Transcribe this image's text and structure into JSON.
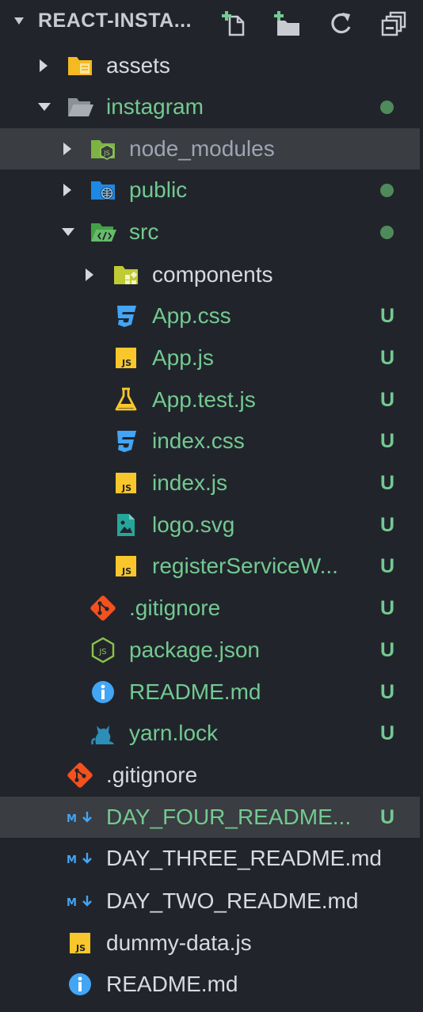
{
  "header": {
    "title": "REACT-INSTA...",
    "actions": [
      {
        "name": "new-file-button",
        "icon": "new-file-icon"
      },
      {
        "name": "new-folder-button",
        "icon": "new-folder-icon"
      },
      {
        "name": "refresh-button",
        "icon": "refresh-icon"
      },
      {
        "name": "collapse-all-button",
        "icon": "collapse-all-icon"
      }
    ]
  },
  "colors": {
    "background": "#21252b",
    "untracked": "#73c991",
    "highlight": "#3a3d41"
  },
  "tree": [
    {
      "label": "assets",
      "type": "folder",
      "expanded": false,
      "icon": "folder-assets-icon",
      "status": ""
    },
    {
      "label": "instagram",
      "type": "folder",
      "expanded": true,
      "icon": "folder-open-icon",
      "status": "dot"
    },
    {
      "label": "node_modules",
      "type": "folder",
      "expanded": false,
      "icon": "folder-node-icon",
      "status": ""
    },
    {
      "label": "public",
      "type": "folder",
      "expanded": false,
      "icon": "folder-public-icon",
      "status": "dot"
    },
    {
      "label": "src",
      "type": "folder",
      "expanded": true,
      "icon": "folder-src-icon",
      "status": "dot"
    },
    {
      "label": "components",
      "type": "folder",
      "expanded": false,
      "icon": "folder-components-icon",
      "status": ""
    },
    {
      "label": "App.css",
      "type": "file",
      "icon": "css-icon",
      "status": "U"
    },
    {
      "label": "App.js",
      "type": "file",
      "icon": "js-icon",
      "status": "U"
    },
    {
      "label": "App.test.js",
      "type": "file",
      "icon": "test-flask-icon",
      "status": "U"
    },
    {
      "label": "index.css",
      "type": "file",
      "icon": "css-icon",
      "status": "U"
    },
    {
      "label": "index.js",
      "type": "file",
      "icon": "js-icon",
      "status": "U"
    },
    {
      "label": "logo.svg",
      "type": "file",
      "icon": "image-icon",
      "status": "U"
    },
    {
      "label": "registerServiceW...",
      "type": "file",
      "icon": "js-icon",
      "status": "U"
    },
    {
      "label": ".gitignore",
      "type": "file",
      "icon": "git-icon",
      "status": "U"
    },
    {
      "label": "package.json",
      "type": "file",
      "icon": "nodejs-icon",
      "status": "U"
    },
    {
      "label": "README.md",
      "type": "file",
      "icon": "info-icon",
      "status": "U"
    },
    {
      "label": "yarn.lock",
      "type": "file",
      "icon": "yarn-cat-icon",
      "status": "U"
    },
    {
      "label": ".gitignore",
      "type": "file",
      "icon": "git-icon",
      "status": ""
    },
    {
      "label": "DAY_FOUR_README...",
      "type": "file",
      "icon": "markdown-icon",
      "status": "U"
    },
    {
      "label": "DAY_THREE_README.md",
      "type": "file",
      "icon": "markdown-icon",
      "status": ""
    },
    {
      "label": "DAY_TWO_README.md",
      "type": "file",
      "icon": "markdown-icon",
      "status": ""
    },
    {
      "label": "dummy-data.js",
      "type": "file",
      "icon": "js-icon",
      "status": ""
    },
    {
      "label": "README.md",
      "type": "file",
      "icon": "info-icon",
      "status": ""
    }
  ]
}
